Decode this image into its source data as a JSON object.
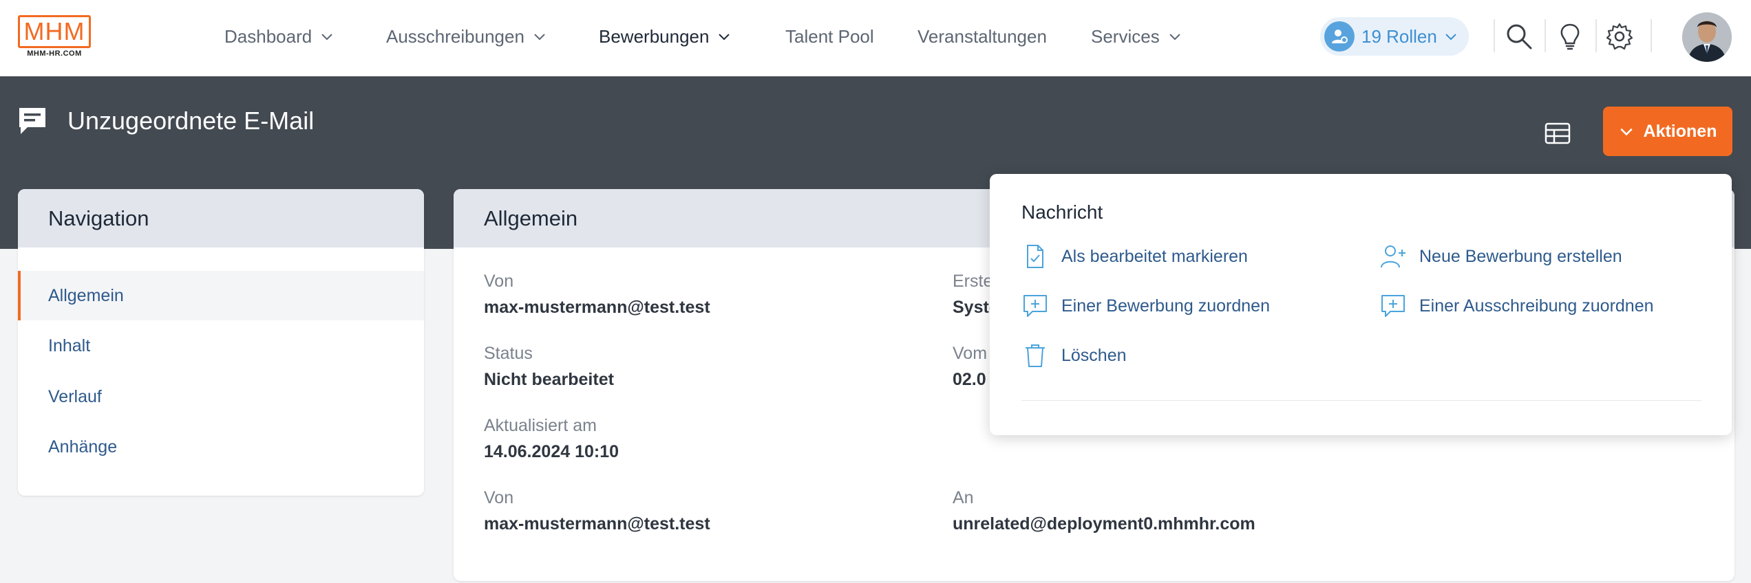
{
  "logo": {
    "text": "MHM",
    "sub": "MHM-HR.COM"
  },
  "nav": {
    "items": [
      {
        "label": "Dashboard",
        "dropdown": true
      },
      {
        "label": "Ausschreibungen",
        "dropdown": true
      },
      {
        "label": "Bewerbungen",
        "dropdown": true
      },
      {
        "label": "Talent Pool",
        "dropdown": false
      },
      {
        "label": "Veranstaltungen",
        "dropdown": false
      },
      {
        "label": "Services",
        "dropdown": true
      }
    ],
    "roles_label": "19 Rollen"
  },
  "page": {
    "title": "Unzugeordnete E-Mail",
    "actions_label": "Aktionen"
  },
  "sidebar": {
    "title": "Navigation",
    "items": [
      {
        "label": "Allgemein"
      },
      {
        "label": "Inhalt"
      },
      {
        "label": "Verlauf"
      },
      {
        "label": "Anhänge"
      }
    ]
  },
  "main": {
    "title": "Allgemein",
    "fields": {
      "von_label": "Von",
      "von_value": "max-mustermann@test.test",
      "erstellt_label": "Erste",
      "erstellt_value": "Syste",
      "status_label": "Status",
      "status_value": "Nicht bearbeitet",
      "vom_label": "Vom",
      "vom_value": "02.0",
      "aktualisiert_label": "Aktualisiert am",
      "aktualisiert_value": "14.06.2024 10:10",
      "von2_label": "Von",
      "von2_value": "max-mustermann@test.test",
      "an_label": "An",
      "an_value": "unrelated@deployment0.mhmhr.com"
    }
  },
  "dropdown": {
    "title": "Nachricht",
    "items": [
      {
        "label": "Als bearbeitet markieren",
        "icon": "document-check-icon"
      },
      {
        "label": "Neue Bewerbung erstellen",
        "icon": "user-add-icon"
      },
      {
        "label": "Einer Bewerbung zuordnen",
        "icon": "comment-plus-icon"
      },
      {
        "label": "Einer Ausschreibung zuordnen",
        "icon": "comment-plus-icon"
      },
      {
        "label": "Löschen",
        "icon": "trash-icon"
      }
    ]
  },
  "colors": {
    "accent": "#f26a21",
    "header_dark": "#434a52",
    "link": "#2e5a8c",
    "roles_blue": "#3d8fd1"
  }
}
